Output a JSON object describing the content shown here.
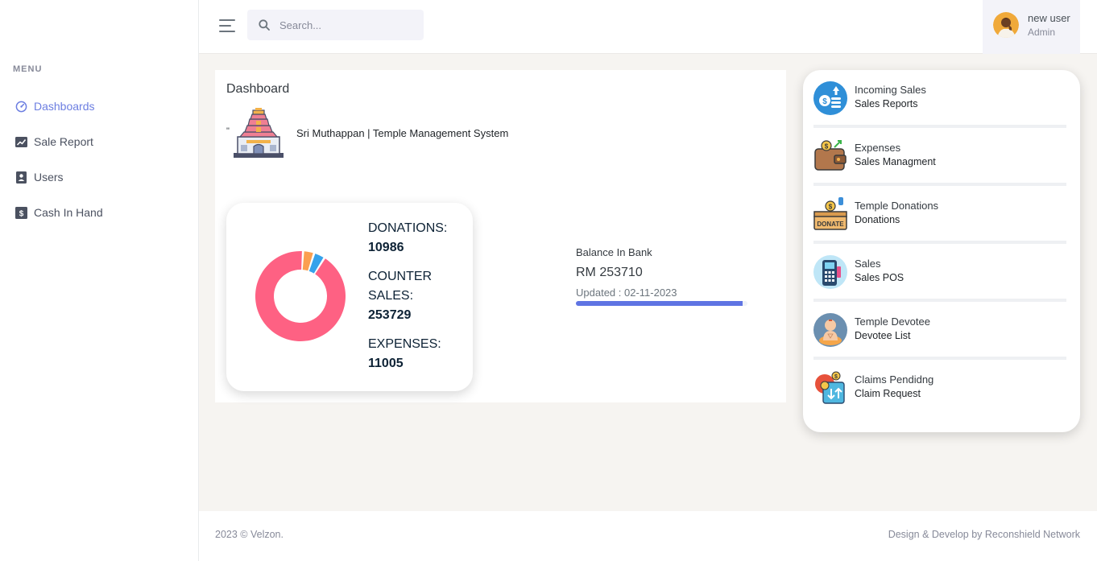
{
  "sidebar": {
    "menu_title": "MENU",
    "items": [
      {
        "label": "Dashboards",
        "icon": "dashboard-gauge-icon",
        "active": true
      },
      {
        "label": "Sale Report",
        "icon": "trend-chart-icon",
        "active": false
      },
      {
        "label": "Users",
        "icon": "user-card-icon",
        "active": false
      },
      {
        "label": "Cash In Hand",
        "icon": "dollar-box-icon",
        "active": false
      }
    ]
  },
  "header": {
    "search_placeholder": "Search...",
    "user": {
      "name": "new user",
      "role": "Admin"
    }
  },
  "main": {
    "title": "Dashboard",
    "quote_mark": "\"",
    "system_title": "Sri Muthappan | Temple Management System",
    "stats": {
      "donations_label": "DONATIONS:",
      "donations_value": "10986",
      "counter_label_1": "COUNTER",
      "counter_label_2": "SALES:",
      "counter_value": "253729",
      "expenses_label": "EXPENSES:",
      "expenses_value": "11005"
    },
    "bank": {
      "label": "Balance In Bank",
      "amount": "RM 253710",
      "updated": "Updated : 02-11-2023",
      "progress_fraction": 0.97
    }
  },
  "chart_data": {
    "type": "pie",
    "categories": [
      "COUNTER SALES",
      "DONATIONS",
      "EXPENSES"
    ],
    "values": [
      253729,
      10986,
      11005
    ],
    "colors": [
      "#fe6183",
      "#fb9f50",
      "#36a2eb"
    ]
  },
  "right_panel": {
    "items": [
      {
        "title": "Incoming Sales",
        "subtitle": "Sales Reports",
        "icon": "incoming-sales-icon"
      },
      {
        "title": "Expenses",
        "subtitle": "Sales Managment",
        "icon": "wallet-icon"
      },
      {
        "title": "Temple Donations",
        "subtitle": "Donations",
        "icon": "donate-box-icon"
      },
      {
        "title": "Sales",
        "subtitle": "Sales POS",
        "icon": "pos-terminal-icon"
      },
      {
        "title": "Temple Devotee",
        "subtitle": "Devotee List",
        "icon": "devotee-icon"
      },
      {
        "title": "Claims Pendidng",
        "subtitle": "Claim Request",
        "icon": "claim-request-icon"
      }
    ]
  },
  "footer": {
    "left": "2023 © Velzon.",
    "right": "Design & Develop by Reconshield Network"
  }
}
